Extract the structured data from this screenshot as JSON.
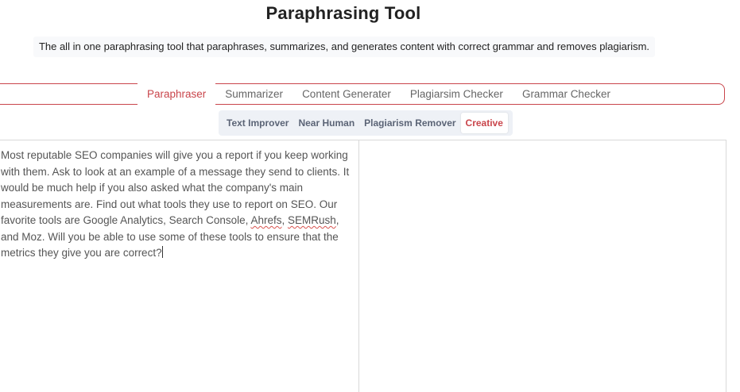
{
  "header": {
    "title": "Paraphrasing Tool",
    "subtitle": "The all in one paraphrasing tool that paraphrases, summarizes, and generates content with correct grammar and removes plagiarism."
  },
  "tabs": [
    {
      "label": "Paraphraser",
      "active": true
    },
    {
      "label": "Summarizer",
      "active": false
    },
    {
      "label": "Content Generater",
      "active": false
    },
    {
      "label": "Plagiarsim Checker",
      "active": false
    },
    {
      "label": "Grammar Checker",
      "active": false
    }
  ],
  "modes": [
    {
      "label": "Text Improver",
      "active": false
    },
    {
      "label": "Near Human",
      "active": false
    },
    {
      "label": "Plagiarism Remover",
      "active": false
    },
    {
      "label": "Creative",
      "active": true
    }
  ],
  "editor": {
    "text_part1": "Most reputable SEO companies will give you a report if you keep working with them. Ask to look at an example of a message they send to clients. It would be much help if you also asked what the company's main measurements are. Find out what tools they use to report on SEO. Our favorite tools are Google Analytics, Search Console, ",
    "spell1": "Ahrefs",
    "sep1": ", ",
    "spell2": "SEMRush",
    "text_part2": ", and Moz. Will you be able to use some of these tools to ensure that the metrics they give you are correct?",
    "output": ""
  },
  "colors": {
    "accent": "#c9454b",
    "mode_bar_bg": "#eef1f6",
    "text": "#555555"
  }
}
